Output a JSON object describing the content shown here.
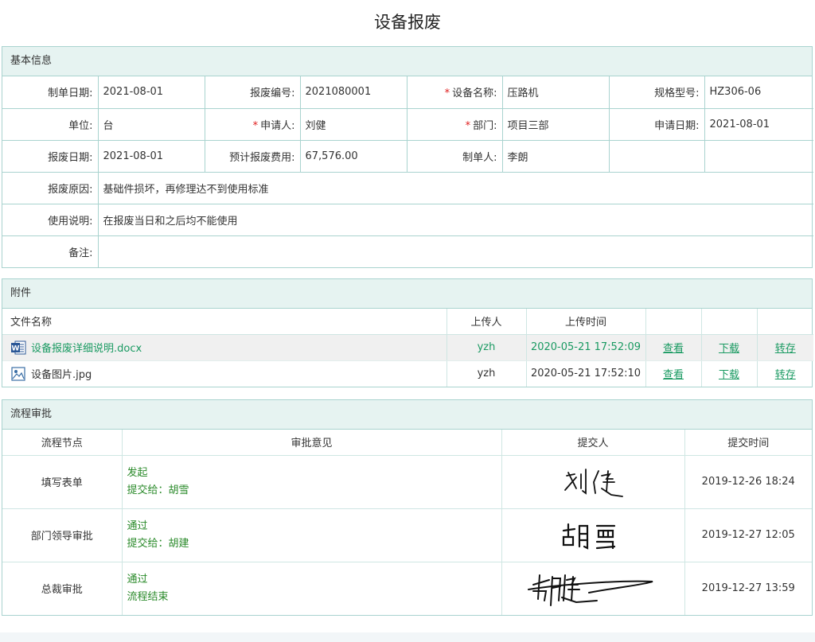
{
  "title": "设备报废",
  "basic": {
    "heading": "基本信息",
    "fields": {
      "create_date": {
        "label": "制单日期:",
        "value": "2021-08-01"
      },
      "scrap_no": {
        "label": "报废编号:",
        "value": "2021080001"
      },
      "equip_name": {
        "label": "设备名称:",
        "value": "压路机",
        "required": "*"
      },
      "spec": {
        "label": "规格型号:",
        "value": "HZ306-06"
      },
      "unit": {
        "label": "单位:",
        "value": "台"
      },
      "applicant": {
        "label": "申请人:",
        "value": "刘健",
        "required": "*"
      },
      "dept": {
        "label": "部门:",
        "value": "项目三部",
        "required": "*"
      },
      "apply_date": {
        "label": "申请日期:",
        "value": "2021-08-01"
      },
      "scrap_date": {
        "label": "报废日期:",
        "value": "2021-08-01"
      },
      "est_cost": {
        "label": "预计报废费用:",
        "value": "67,576.00"
      },
      "creator": {
        "label": "制单人:",
        "value": "李朗"
      },
      "reason": {
        "label": "报废原因:",
        "value": "基础件损坏，再修理达不到使用标准"
      },
      "usage": {
        "label": "使用说明:",
        "value": "在报废当日和之后均不能使用"
      },
      "remark": {
        "label": "备注:",
        "value": ""
      }
    }
  },
  "attachments": {
    "heading": "附件",
    "columns": [
      "文件名称",
      "上传人",
      "上传时间"
    ],
    "rows": [
      {
        "icon": "word-doc-icon",
        "name": "设备报废详细说明.docx",
        "uploader": "yzh",
        "time": "2020-05-21 17:52:09",
        "view": "查看",
        "download": "下载",
        "save": "转存"
      },
      {
        "icon": "image-file-icon",
        "name": "设备图片.jpg",
        "uploader": "yzh",
        "time": "2020-05-21 17:52:10",
        "view": "查看",
        "download": "下载",
        "save": "转存"
      }
    ]
  },
  "flow": {
    "heading": "流程审批",
    "columns": [
      "流程节点",
      "审批意见",
      "提交人",
      "提交时间"
    ],
    "rows": [
      {
        "node": "填写表单",
        "opinion1": "发起",
        "opinion2": "提交给：胡雪",
        "signature": "刘健",
        "time": "2019-12-26 18:24"
      },
      {
        "node": "部门领导审批",
        "opinion1": "通过",
        "opinion2": "提交给：胡建",
        "signature": "胡雪",
        "time": "2019-12-27 12:05"
      },
      {
        "node": "总裁审批",
        "opinion1": "通过",
        "opinion2": "流程结束",
        "signature": "胡建",
        "time": "2019-12-27 13:59"
      }
    ]
  },
  "colors": {
    "border": "#a9d3cf",
    "header_bg": "#e6f3f1",
    "link": "#1a9a62",
    "required": "#e02020",
    "opinion": "#2a8a2a"
  }
}
